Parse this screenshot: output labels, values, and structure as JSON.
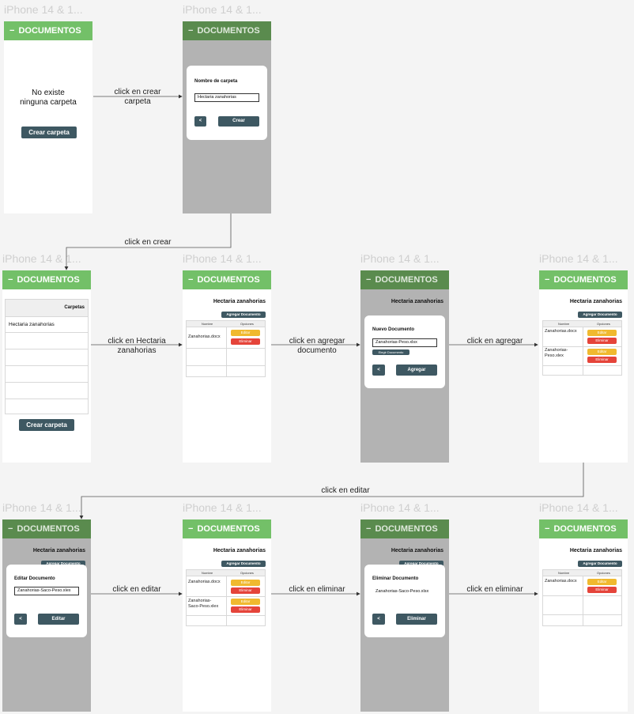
{
  "frame_label": "iPhone 14 & 1...",
  "header": {
    "minus": "−",
    "title": "DOCUMENTOS"
  },
  "folder": {
    "name": "Hectaria zanahorias",
    "title": "Hectaria zanahorias"
  },
  "empty_text_1": "No existe",
  "empty_text_2": "ninguna carpeta",
  "crear_carpeta": "Crear carpeta",
  "modal_folder": {
    "title": "Nombre de carpeta",
    "value": "Hectaria zanahorias",
    "back": "<",
    "ok": "Crear"
  },
  "list_header": "Carpetas",
  "add_doc_btn": "Agregar Documento",
  "table": {
    "col_name": "Nombre",
    "col_opts": "Opciones"
  },
  "docs": {
    "doc1": "Zanahorias.docx",
    "doc2a": "Zanahorias-",
    "doc2b": "Peso.xlex",
    "doc2c": "Zanahorias-",
    "doc2d": "Saco-Peso.xlex"
  },
  "edit_btn": "Editar",
  "delete_btn": "Eliminar",
  "modal_new": {
    "title": "Nuevo Documento",
    "value": "Zanahorias-Peso.xlsx",
    "choose": "Elegir Documento",
    "back": "<",
    "ok": "Agregar"
  },
  "modal_edit": {
    "title": "Editar Documento",
    "value": "Zanahorias-Saco-Peso.xlex",
    "back": "<",
    "ok": "Editar"
  },
  "modal_del": {
    "title": "Eliminar Documento",
    "value": "Zanahorias-Saco-Peso.xlsx",
    "back": "<",
    "ok": "Eliminar"
  },
  "flow": {
    "a1a": "click en crear",
    "a1b": "carpeta",
    "a2": "click en crear",
    "a3a": "click en Hectaria",
    "a3b": "zanahorias",
    "a4a": "click en agregar",
    "a4b": "documento",
    "a5": "click en agregar",
    "a6": "click en editar",
    "a7": "click en editar",
    "a8": "click en eliminar",
    "a9": "click en eliminar"
  }
}
